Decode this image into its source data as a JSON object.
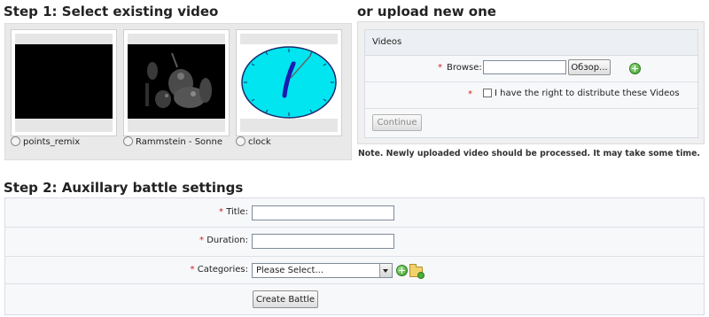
{
  "step1": {
    "title": "Step 1: Select existing video",
    "videos": [
      {
        "name": "points_remix",
        "thumb": "black-video-frame"
      },
      {
        "name": "Rammstein - Sonne",
        "thumb": "dark-concert-frame"
      },
      {
        "name": "clock",
        "thumb": "cyan-clock-frame"
      }
    ]
  },
  "upload": {
    "title": "or upload new one",
    "panel_header": "Videos",
    "browse_label": "Browse:",
    "browse_button": "Обзор...",
    "rights_label": "I have the right to distribute these Videos",
    "continue_button": "Continue",
    "required_mark": "*",
    "note": "Note. Newly uploaded video should be processed. It may take some time."
  },
  "step2": {
    "title": "Step 2: Auxillary battle settings",
    "required_mark": "*",
    "fields": {
      "title_label": "Title:",
      "title_value": "",
      "duration_label": "Duration:",
      "duration_value": "",
      "categories_label": "Categories:",
      "categories_selected": "Please Select..."
    },
    "create_button": "Create Battle"
  },
  "icons": {
    "add_video": "plus-circle-icon",
    "add_category": "plus-circle-icon",
    "new_folder": "folder-add-icon",
    "dropdown": "chevron-down-icon"
  },
  "colors": {
    "required": "#d02020",
    "clock_face": "#00e5f0",
    "clock_hand": "#1a1ab0"
  }
}
